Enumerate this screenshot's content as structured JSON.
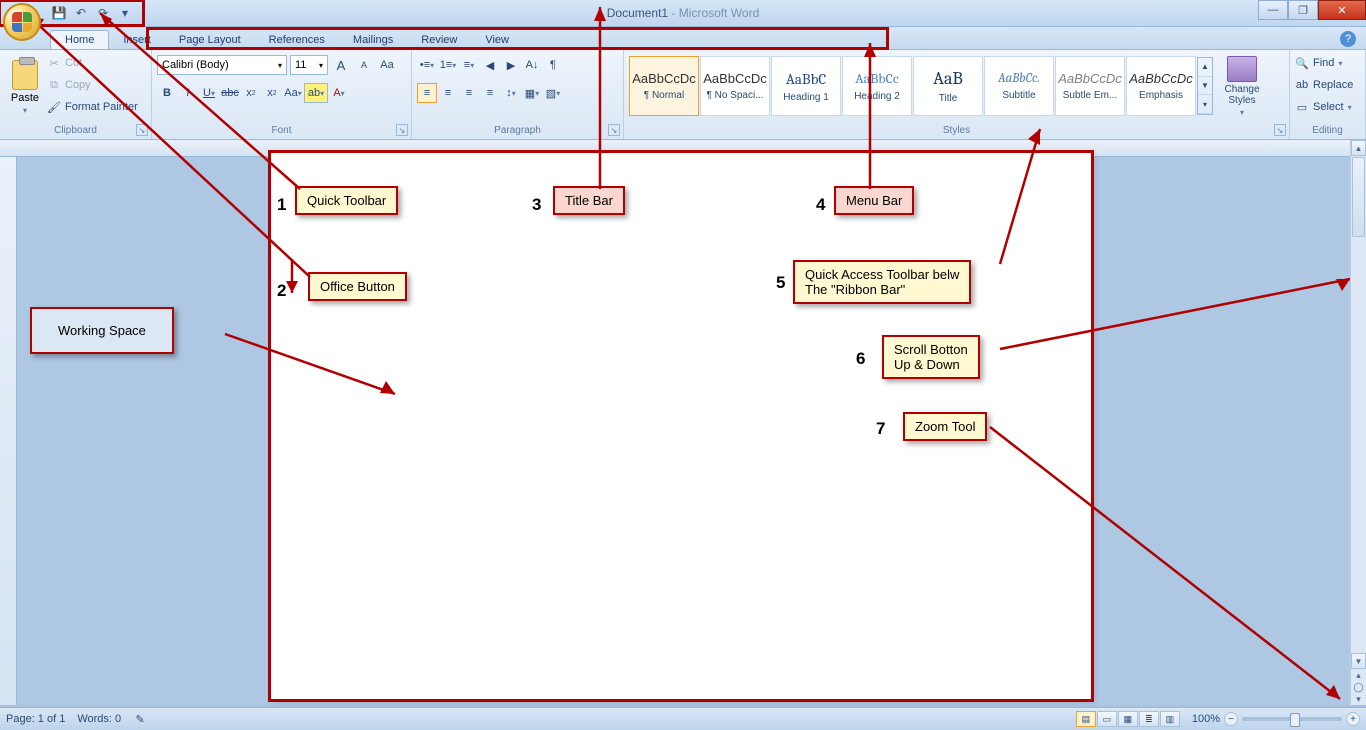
{
  "titlebar": {
    "doc": "Document1",
    "sep": " - ",
    "app": "Microsoft Word"
  },
  "qat": {
    "save": "💾",
    "undo": "↶",
    "redo": "↷",
    "more": "▾"
  },
  "win": {
    "min": "—",
    "max": "❐",
    "close": "✕"
  },
  "tabs": [
    "Home",
    "Insert",
    "Page Layout",
    "References",
    "Mailings",
    "Review",
    "View"
  ],
  "help": "?",
  "clipboard": {
    "paste": "Paste",
    "cut": "Cut",
    "copy": "Copy",
    "format_painter": "Format Painter",
    "label": "Clipboard"
  },
  "font": {
    "name": "Calibri (Body)",
    "size": "11",
    "grow": "A",
    "shrink": "A",
    "clear": "Aa",
    "bold": "B",
    "italic": "I",
    "under": "U",
    "strike": "abc",
    "sub": "x",
    "sup": "x",
    "case": "Aa",
    "highlight": "ab",
    "color": "A",
    "label": "Font"
  },
  "paragraph": {
    "bullets": "•≡",
    "numbers": "1≡",
    "multi": "≡",
    "dec_ind": "◀",
    "inc_ind": "▶",
    "sort": "A↓",
    "show": "¶",
    "al": "≡",
    "ac": "≡",
    "ar": "≡",
    "aj": "≡",
    "ls": "↕",
    "shade": "▦",
    "border": "▧",
    "label": "Paragraph"
  },
  "styles": {
    "items": [
      {
        "sample": "AaBbCcDc",
        "name": "¶ Normal",
        "cls": ""
      },
      {
        "sample": "AaBbCcDc",
        "name": "¶ No Spaci...",
        "cls": ""
      },
      {
        "sample": "AaBbC",
        "name": "Heading 1",
        "cls": "h1"
      },
      {
        "sample": "AaBbCc",
        "name": "Heading 2",
        "cls": "h2"
      },
      {
        "sample": "AaB",
        "name": "Title",
        "cls": "title"
      },
      {
        "sample": "AaBbCc.",
        "name": "Subtitle",
        "cls": "subtitle"
      },
      {
        "sample": "AaBbCcDc",
        "name": "Subtle Em...",
        "cls": "subtle"
      },
      {
        "sample": "AaBbCcDc",
        "name": "Emphasis",
        "cls": "emph"
      }
    ],
    "change": "Change Styles",
    "label": "Styles"
  },
  "editing": {
    "find": "Find",
    "replace": "Replace",
    "select": "Select",
    "label": "Editing"
  },
  "callouts": {
    "c1": "Quick Toolbar",
    "c2": "Office Button",
    "c3": "Title Bar",
    "c4": "Menu Bar",
    "c5": "Quick Access Toolbar belw\nThe \"Ribbon Bar\"",
    "c6": "Scroll Botton\nUp & Down",
    "c7": "Zoom Tool",
    "ws": "Working Space"
  },
  "nums": {
    "n1": "1",
    "n2": "2",
    "n3": "3",
    "n4": "4",
    "n5": "5",
    "n6": "6",
    "n7": "7"
  },
  "status": {
    "page": "Page: 1 of 1",
    "words": "Words: 0",
    "zoom_pct": "100%"
  }
}
